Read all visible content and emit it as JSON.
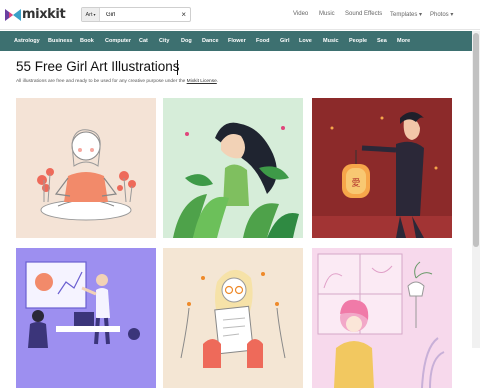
{
  "brand": {
    "name": "mixkit"
  },
  "search": {
    "scope": "Art",
    "value": "Girl",
    "clear": "×"
  },
  "topnav": [
    {
      "label": "Video"
    },
    {
      "label": "Music"
    },
    {
      "label": "Sound Effects"
    },
    {
      "label": "Templates",
      "caret": "▾"
    },
    {
      "label": "Photos",
      "caret": "▾"
    }
  ],
  "categories": [
    "Astrology",
    "Business",
    "Book",
    "Computer",
    "Cat",
    "City",
    "Dog",
    "Dance",
    "Flower",
    "Food",
    "Girl",
    "Love",
    "Music",
    "People",
    "Sea",
    "More"
  ],
  "page": {
    "title": "55 Free Girl Art Illustrations",
    "subtitle_prefix": "All illustrations are free and ready to be used for any creative purpose under the ",
    "license_link": "Mixkit License",
    "subtitle_suffix": "."
  },
  "colors": {
    "accent": "#3d7070",
    "card1_bg": "#f4e3d6",
    "card2_bg": "#d6edd9",
    "card3_bg": "#8c2a2a",
    "card4_bg": "#9d8ff0",
    "card5_bg": "#f4e6d4",
    "card6_bg": "#f7d9ec"
  },
  "cards": [
    {
      "name": "girl-meditating"
    },
    {
      "name": "girl-with-leaves"
    },
    {
      "name": "girl-with-lantern"
    },
    {
      "name": "office-presentation"
    },
    {
      "name": "girl-reading-paper"
    },
    {
      "name": "girl-at-window"
    }
  ]
}
